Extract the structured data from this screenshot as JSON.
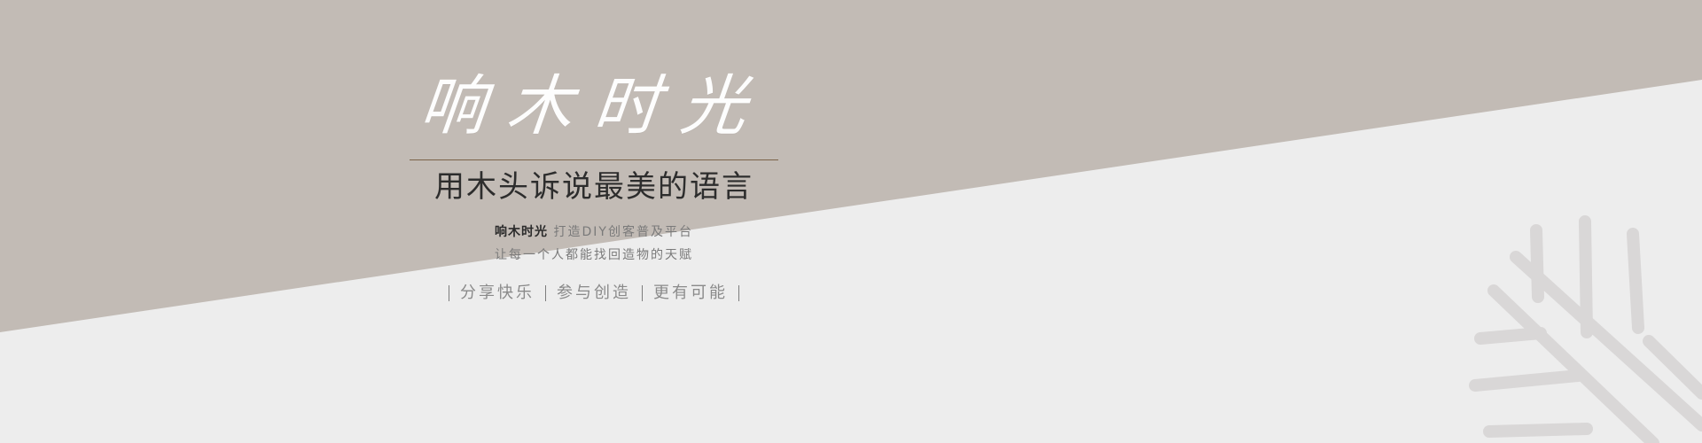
{
  "brand": {
    "title": "响木时光",
    "subtitle": "用木头诉说最美的语言",
    "line1_strong": "响木时光",
    "line1_rest": "打造DIY创客普及平台",
    "line2": "让每一个人都能找回造物的天赋"
  },
  "tags": [
    "分享快乐",
    "参与创造",
    "更有可能"
  ],
  "colors": {
    "top_band": "#c2bbb5",
    "page_bg": "#ededed",
    "divider": "#7a6248",
    "title_text": "#ffffff",
    "subtitle_text": "#2d2d2d",
    "muted_text": "#7a7a7a",
    "decor_line": "#d9d7d7"
  },
  "decor": {
    "icon": "wood-grain-branch-icon"
  }
}
